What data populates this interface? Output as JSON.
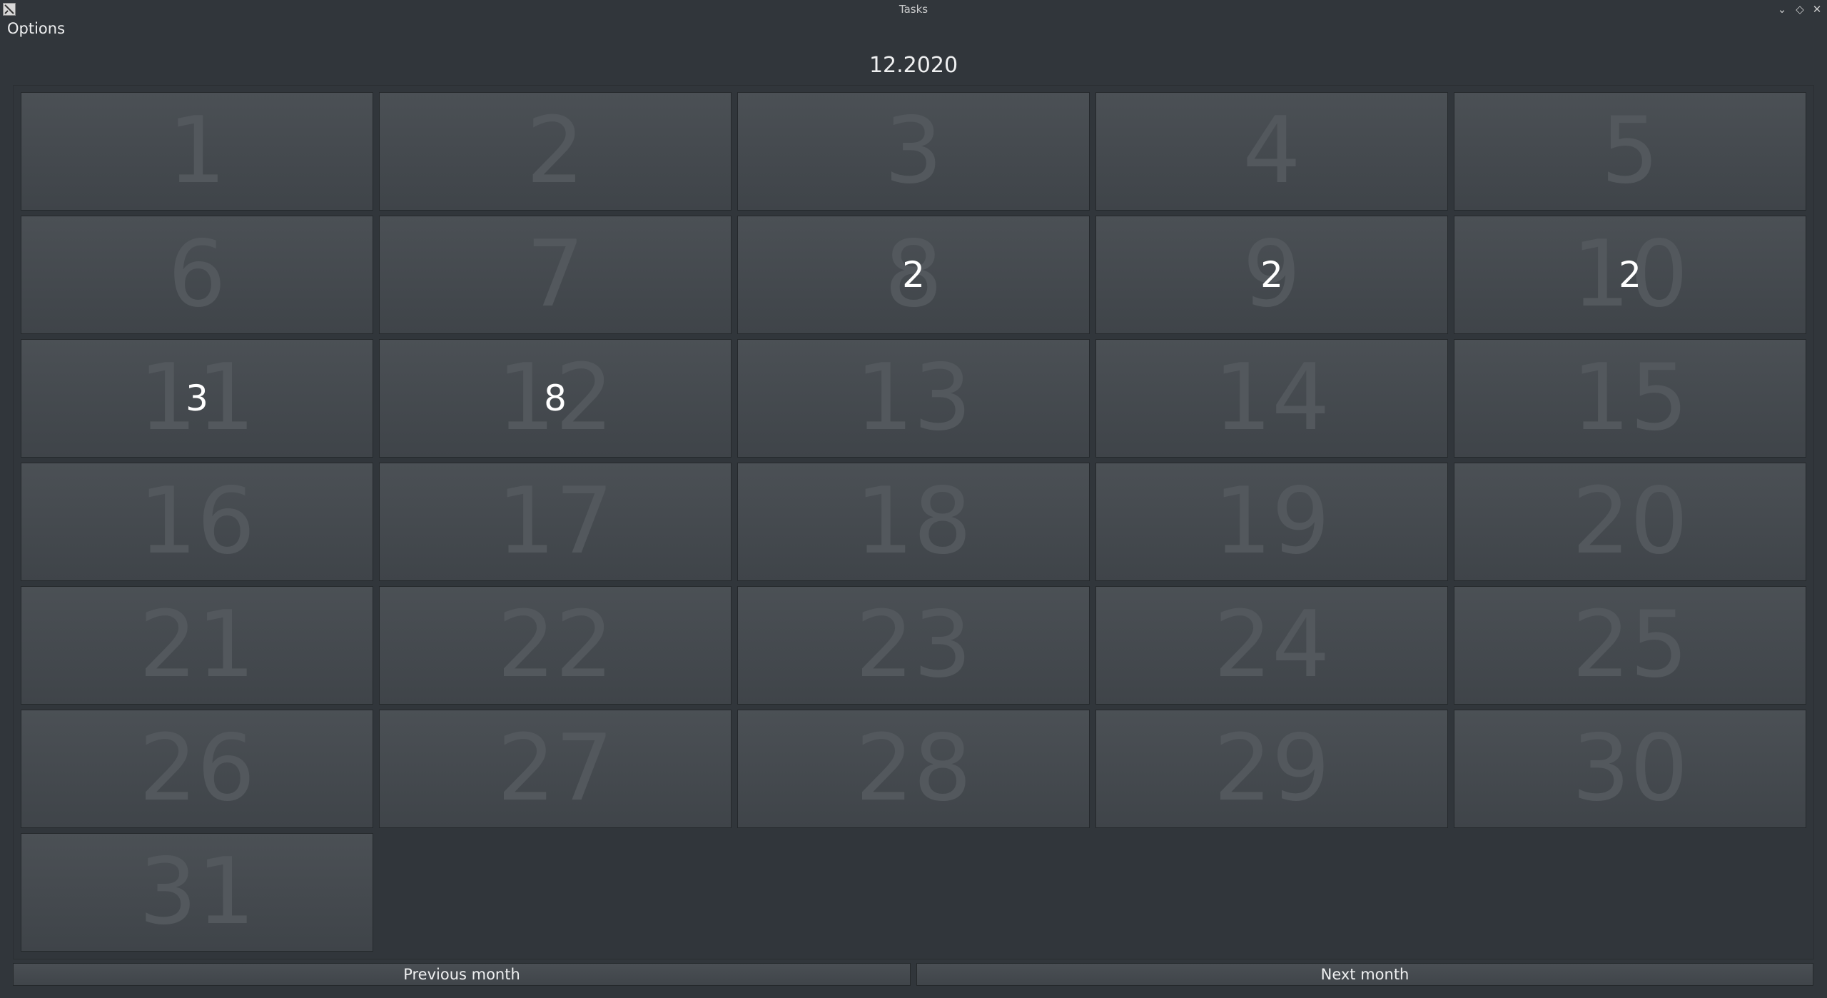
{
  "window": {
    "title": "Tasks"
  },
  "menu": {
    "options": "Options"
  },
  "calendar": {
    "month_label": "12.2020",
    "days": [
      {
        "day": "1",
        "count": ""
      },
      {
        "day": "2",
        "count": ""
      },
      {
        "day": "3",
        "count": ""
      },
      {
        "day": "4",
        "count": ""
      },
      {
        "day": "5",
        "count": ""
      },
      {
        "day": "6",
        "count": ""
      },
      {
        "day": "7",
        "count": ""
      },
      {
        "day": "8",
        "count": "2"
      },
      {
        "day": "9",
        "count": "2"
      },
      {
        "day": "10",
        "count": "2"
      },
      {
        "day": "11",
        "count": "3"
      },
      {
        "day": "12",
        "count": "8"
      },
      {
        "day": "13",
        "count": ""
      },
      {
        "day": "14",
        "count": ""
      },
      {
        "day": "15",
        "count": ""
      },
      {
        "day": "16",
        "count": ""
      },
      {
        "day": "17",
        "count": ""
      },
      {
        "day": "18",
        "count": ""
      },
      {
        "day": "19",
        "count": ""
      },
      {
        "day": "20",
        "count": ""
      },
      {
        "day": "21",
        "count": ""
      },
      {
        "day": "22",
        "count": ""
      },
      {
        "day": "23",
        "count": ""
      },
      {
        "day": "24",
        "count": ""
      },
      {
        "day": "25",
        "count": ""
      },
      {
        "day": "26",
        "count": ""
      },
      {
        "day": "27",
        "count": ""
      },
      {
        "day": "28",
        "count": ""
      },
      {
        "day": "29",
        "count": ""
      },
      {
        "day": "30",
        "count": ""
      },
      {
        "day": "31",
        "count": ""
      }
    ]
  },
  "nav": {
    "previous": "Previous month",
    "next": "Next month"
  },
  "icons": {
    "minimize": "chevron-down-icon",
    "maximize": "diamond-icon",
    "close": "close-icon",
    "app": "app-icon"
  }
}
